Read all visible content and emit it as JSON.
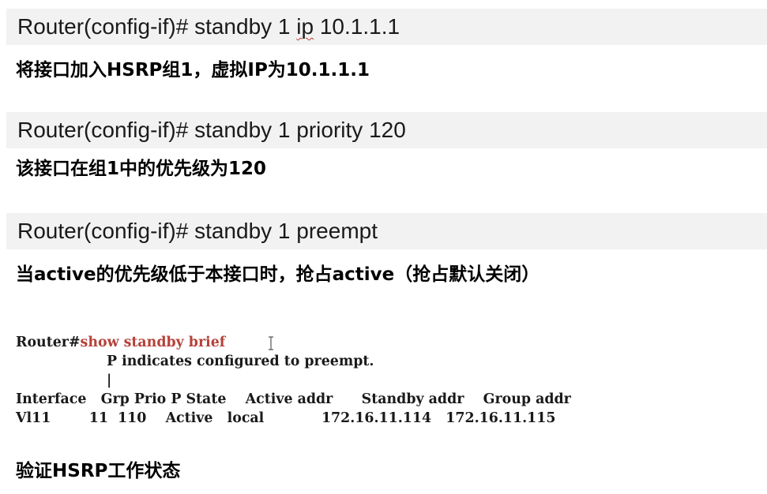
{
  "sections": [
    {
      "cmd_prefix": "Router(config-if)# standby 1 ",
      "cmd_mark": "ip",
      "cmd_suffix": " 10.1.1.1",
      "desc": "将接口加入HSRP组1，虚拟IP为10.1.1.1"
    },
    {
      "cmd": "Router(config-if)# standby 1 priority 120",
      "desc": "该接口在组1中的优先级为120"
    },
    {
      "cmd": "Router(config-if)# standby 1 preempt",
      "desc": "当active的优先级低于本接口时，抢占active（抢占默认关闭）"
    }
  ],
  "cli": {
    "prompt": "Router#",
    "command": "show standby brief",
    "note_line": "                   P indicates configured to preempt.",
    "pipe_line": "                   |",
    "header_line": "Interface   Grp Prio P State    Active addr      Standby addr    Group addr",
    "row_line": "Vl11        11  110    Active   local            172.16.11.114   172.16.11.115"
  },
  "footer": "验证HSRP工作状态",
  "icons": {
    "cursor": "text-cursor-icon"
  },
  "colors": {
    "command_bar": "#f2f2f2",
    "cli_keyword": "#b5423a",
    "spellcheck_underline": "#c0392b"
  }
}
